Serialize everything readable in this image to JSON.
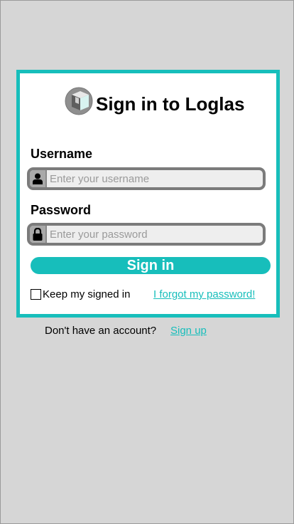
{
  "app": {
    "title": "Sign in to Loglas",
    "logo_icon": "loglas-cube-logo"
  },
  "form": {
    "username_label": "Username",
    "username_placeholder": "Enter your username",
    "username_value": "",
    "username_icon": "user-icon",
    "password_label": "Password",
    "password_placeholder": "Enter your password",
    "password_value": "",
    "password_icon": "lock-icon",
    "signin_label": "Sign in",
    "keep_signed_in_label": "Keep my signed in",
    "keep_signed_in_checked": false,
    "forgot_password_label": "I forgot my password!"
  },
  "footer": {
    "no_account_text": "Don't have an account?",
    "signup_label": "Sign up"
  },
  "colors": {
    "accent": "#17bebb",
    "background": "#d6d6d6",
    "card": "#ffffff",
    "input_border": "#7b7b7b"
  }
}
